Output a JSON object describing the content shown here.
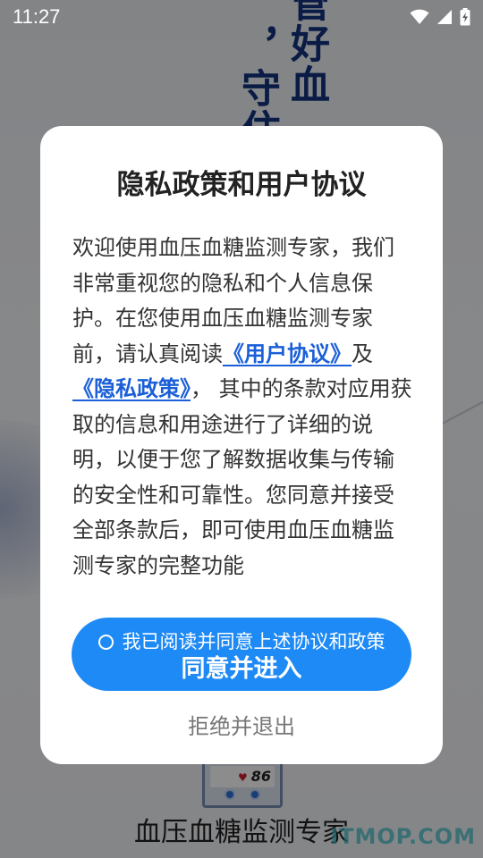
{
  "status_bar": {
    "time": "11:27",
    "icons": [
      "wifi-icon",
      "cellular-signal-icon",
      "battery-charging-icon"
    ]
  },
  "background": {
    "slogan_right": "管好血",
    "slogan_left": "，守住",
    "device_display": "86",
    "app_name": "血压血糖监测专家",
    "watermark": "ITMOP.COM"
  },
  "dialog": {
    "title": "隐私政策和用户协议",
    "body_intro": "欢迎使用血压血糖监测专家，我们非常重视您的隐私和个人信息保护。在您使用血压血糖监测专家前，请认真阅读",
    "user_agreement_link": "《用户协议》",
    "conjunction": "及",
    "privacy_policy_link": "《隐私政策》",
    "body_rest": "， 其中的条款对应用获取的信息和用途进行了详细的说明，以便于您了解数据收集与传输的安全性和可靠性。您同意并接受全部条款后，即可使用血压血糖监测专家的完整功能",
    "consent_checkbox_label": "我已阅读并同意上述协议和政策",
    "agree_button_label": "同意并进入",
    "reject_button_label": "拒绝并退出"
  },
  "colors": {
    "accent": "#1e8af5",
    "link": "#1a5fd8",
    "slogan": "#13347f"
  }
}
